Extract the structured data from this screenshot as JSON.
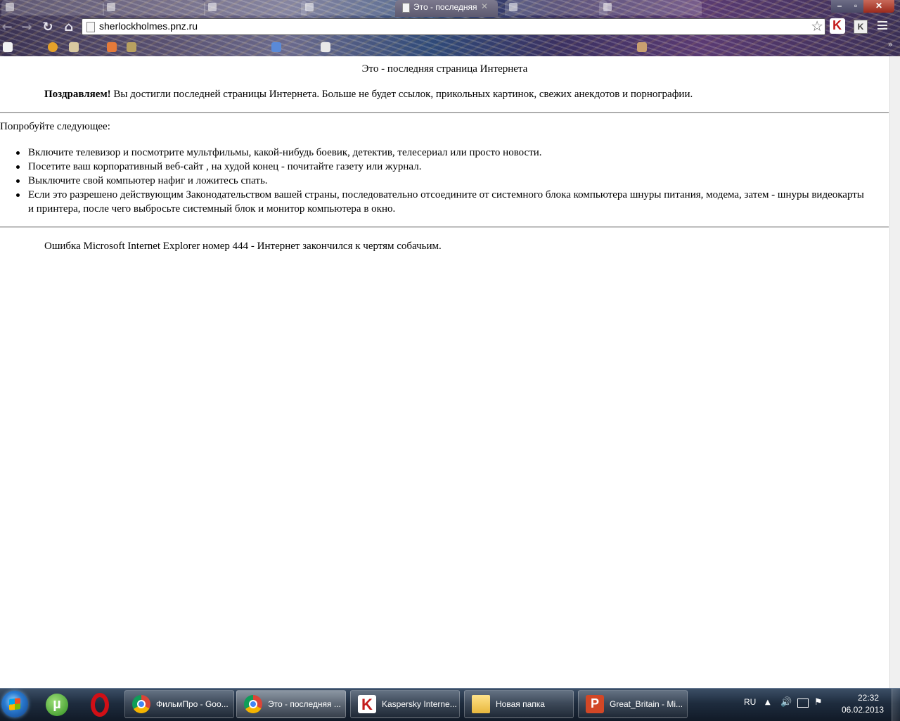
{
  "browser": {
    "active_tab_title": "Это - последняя",
    "background_tabs": [
      "",
      "",
      "",
      "",
      "",
      ""
    ],
    "url": "sherlockholmes.pnz.ru",
    "icons": {
      "back": "arrow-left-icon",
      "forward": "arrow-right-icon",
      "reload": "reload-icon",
      "home": "home-icon",
      "star": "star-icon",
      "menu": "menu-icon"
    },
    "ext_k2_label": "K"
  },
  "page": {
    "heading": "Это - последняя страница Интернета",
    "congrats_bold": "Поздравляем!",
    "congrats_text": " Вы достигли последней страницы Интернета. Больше не будет ссылок, прикольных картинок, свежих анекдотов и порнографии.",
    "try_intro": "Попробуйте следующее:",
    "suggestions": [
      "Включите телевизор и посмотрите мультфильмы, какой-нибудь боевик, детектив, телесериал или просто новости.",
      "Посетите ваш корпоративный веб-сайт , на худой конец - почитайте газету или журнал.",
      "Выключите свой компьютер нафиг и ложитесь спать.",
      "Если это разрешено действующим Законодательством вашей страны, последовательно отсоедините от системного блока компьютера шнуры питания, модема, затем - шнуры видеокарты и принтера, после чего выбросьте системный блок и монитор компьютера в окно."
    ],
    "error_line": "Ошибка Microsoft Internet Explorer номер 444 - Интернет закончился к чертям собачьим."
  },
  "taskbar": {
    "tasks": [
      {
        "label": "ФильмПро - Goo...",
        "icon": "chrome-icon"
      },
      {
        "label": "Это - последняя ...",
        "icon": "chrome-icon"
      },
      {
        "label": "Kaspersky Interne...",
        "icon": "kaspersky-icon"
      },
      {
        "label": "Новая папка",
        "icon": "folder-icon"
      },
      {
        "label": "Great_Britain - Mi...",
        "icon": "powerpoint-icon"
      }
    ],
    "pinned": [
      "utorrent-icon",
      "opera-icon"
    ],
    "tray": {
      "language": "RU",
      "time": "22:32",
      "date": "06.02.2013"
    }
  },
  "colors": {
    "page_background": "#ffffff",
    "taskbar": "#1e2c3e",
    "chrome_theme": "#3a3152"
  }
}
